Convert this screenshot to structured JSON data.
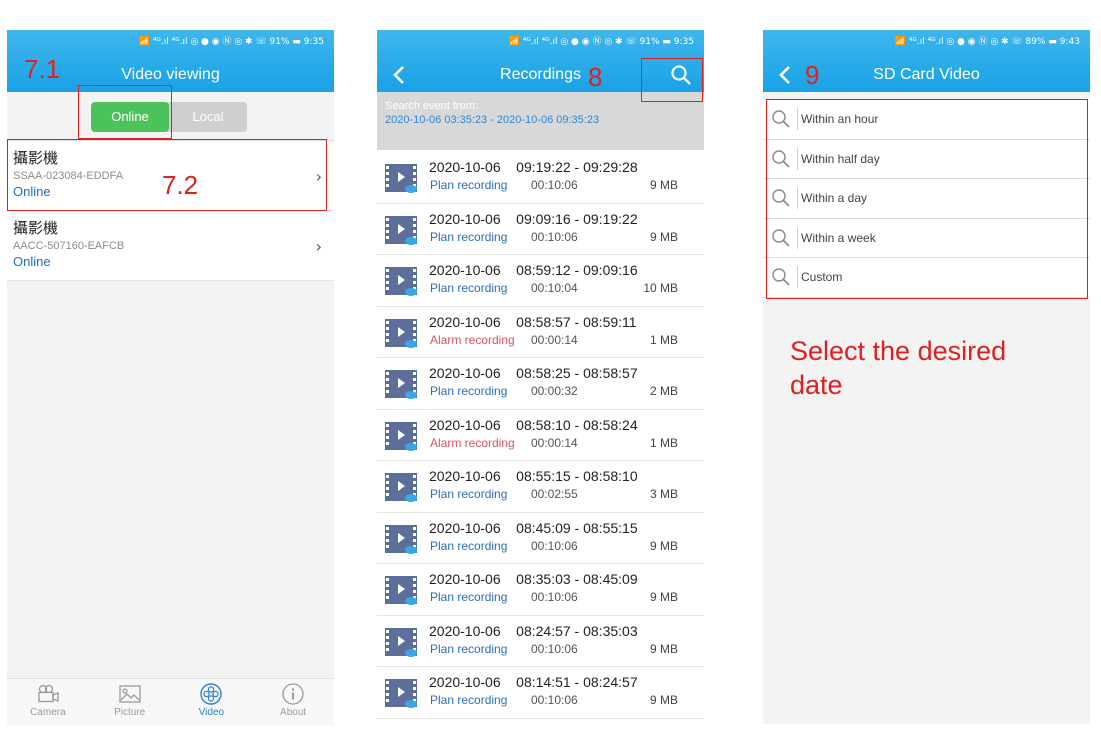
{
  "phone1": {
    "status": "📶 ⁴ᴳ.ıl ⁴ᴳ.ıl ◎ ● ◉ Ⓝ ◎ ✱ ☏ 91% ▬ 9:35",
    "title": "Video viewing",
    "segments": {
      "online": "Online",
      "local": "Local"
    },
    "devices": [
      {
        "name": "攝影機",
        "id": "SSAA-023084-EDDFA",
        "status": "Online"
      },
      {
        "name": "攝影機",
        "id": "AACC-507160-EAFCB",
        "status": "Online"
      }
    ],
    "tabs": [
      {
        "label": "Camera",
        "icon": "camera-icon"
      },
      {
        "label": "Picture",
        "icon": "picture-icon"
      },
      {
        "label": "Video",
        "icon": "video-icon"
      },
      {
        "label": "About",
        "icon": "info-icon"
      }
    ]
  },
  "phone2": {
    "status": "📶 ⁴ᴳ.ıl ⁴ᴳ.ıl ◎ ● ◉ Ⓝ ◎ ✱ ☏ 91% ▬ 9:35",
    "title": "Recordings",
    "search_label": "Search event from:",
    "search_range": "2020-10-06 03:35:23 - 2020-10-06 09:35:23",
    "recordings": [
      {
        "date": "2020-10-06",
        "range": "09:19:22 - 09:29:28",
        "type": "Plan recording",
        "kind": "plan",
        "duration": "00:10:06",
        "size": "9 MB"
      },
      {
        "date": "2020-10-06",
        "range": "09:09:16 - 09:19:22",
        "type": "Plan recording",
        "kind": "plan",
        "duration": "00:10:06",
        "size": "9 MB"
      },
      {
        "date": "2020-10-06",
        "range": "08:59:12 - 09:09:16",
        "type": "Plan recording",
        "kind": "plan",
        "duration": "00:10:04",
        "size": "10 MB"
      },
      {
        "date": "2020-10-06",
        "range": "08:58:57 - 08:59:11",
        "type": "Alarm recording",
        "kind": "alarm",
        "duration": "00:00:14",
        "size": "1 MB"
      },
      {
        "date": "2020-10-06",
        "range": "08:58:25 - 08:58:57",
        "type": "Plan recording",
        "kind": "plan",
        "duration": "00:00:32",
        "size": "2 MB"
      },
      {
        "date": "2020-10-06",
        "range": "08:58:10 - 08:58:24",
        "type": "Alarm recording",
        "kind": "alarm",
        "duration": "00:00:14",
        "size": "1 MB"
      },
      {
        "date": "2020-10-06",
        "range": "08:55:15 - 08:58:10",
        "type": "Plan recording",
        "kind": "plan",
        "duration": "00:02:55",
        "size": "3 MB"
      },
      {
        "date": "2020-10-06",
        "range": "08:45:09 - 08:55:15",
        "type": "Plan recording",
        "kind": "plan",
        "duration": "00:10:06",
        "size": "9 MB"
      },
      {
        "date": "2020-10-06",
        "range": "08:35:03 - 08:45:09",
        "type": "Plan recording",
        "kind": "plan",
        "duration": "00:10:06",
        "size": "9 MB"
      },
      {
        "date": "2020-10-06",
        "range": "08:24:57 - 08:35:03",
        "type": "Plan recording",
        "kind": "plan",
        "duration": "00:10:06",
        "size": "9 MB"
      },
      {
        "date": "2020-10-06",
        "range": "08:14:51 - 08:24:57",
        "type": "Plan recording",
        "kind": "plan",
        "duration": "00:10:06",
        "size": "9 MB"
      }
    ]
  },
  "phone3": {
    "status": "📶 ⁴ᴳ.ıl ⁴ᴳ.ıl ◎ ● ◉ Ⓝ ◎ ✱ ☏ 89% ▬ 9:43",
    "title": "SD Card Video",
    "filters": [
      "Within an hour",
      "Within half day",
      "Within a day",
      "Within a week",
      "Custom"
    ]
  },
  "annotations": {
    "a71": "7.1",
    "a72": "7.2",
    "a8": "8",
    "a9": "9",
    "instruction_line1": "Select the desired",
    "instruction_line2": "date"
  },
  "colors": {
    "header": "#19a2e6",
    "online_green": "#4cc25a",
    "annotation_red": "#e02020",
    "alarm_red": "#d8545d",
    "link_blue": "#1e6ec0"
  }
}
